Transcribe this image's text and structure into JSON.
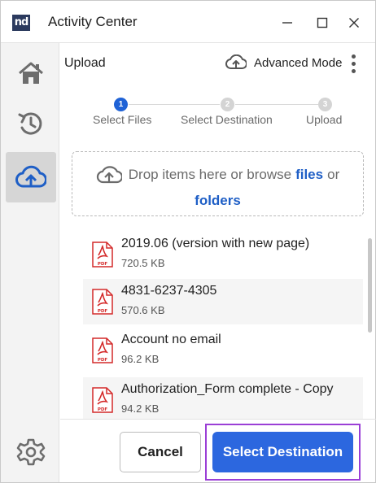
{
  "window": {
    "logo_text": "nd",
    "title": "Activity Center"
  },
  "sidebar": {
    "items": [
      {
        "icon": "home-icon",
        "active": false
      },
      {
        "icon": "history-icon",
        "active": false
      },
      {
        "icon": "cloud-upload-icon",
        "active": true
      },
      {
        "icon": "gear-icon",
        "active": false
      }
    ]
  },
  "header": {
    "title": "Upload",
    "advanced_mode_label": "Advanced Mode"
  },
  "stepper": {
    "steps": [
      {
        "number": "1",
        "label": "Select Files",
        "active": true
      },
      {
        "number": "2",
        "label": "Select Destination",
        "active": false
      },
      {
        "number": "3",
        "label": "Upload",
        "active": false
      }
    ]
  },
  "dropzone": {
    "text_before": "Drop items here or browse",
    "files_link": "files",
    "or_text": "or",
    "folders_link": "folders"
  },
  "files": [
    {
      "name": "2019.06 (version with new page)",
      "size": "720.5 KB"
    },
    {
      "name": "4831-6237-4305",
      "size": "570.6 KB"
    },
    {
      "name": "Account no email",
      "size": "96.2 KB"
    },
    {
      "name": "Authorization_Form complete - Copy",
      "size": "94.2 KB"
    }
  ],
  "footer": {
    "cancel_label": "Cancel",
    "primary_label": "Select Destination"
  },
  "colors": {
    "accent": "#2c67df",
    "highlight_frame": "#9b3fd6",
    "pdf_red": "#d42a2a"
  }
}
